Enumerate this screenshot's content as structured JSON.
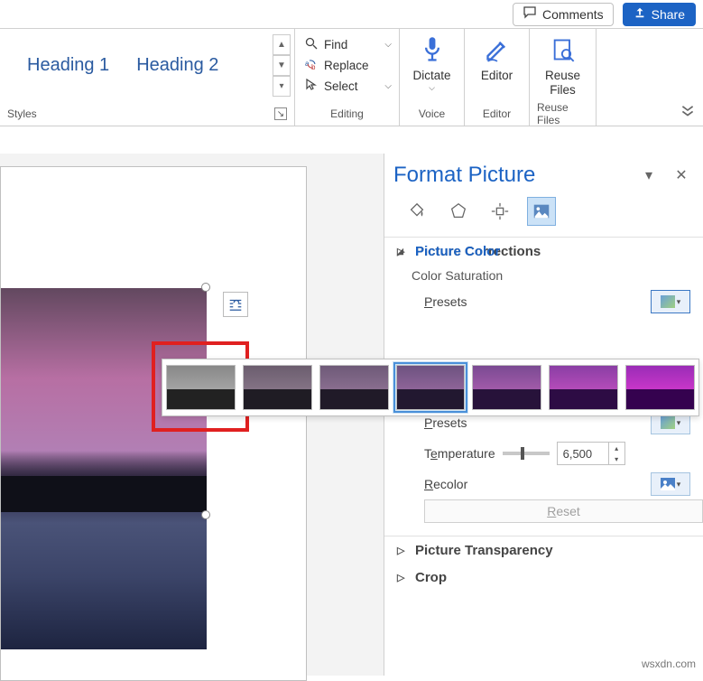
{
  "topbar": {
    "comments": "Comments",
    "share": "Share"
  },
  "ribbon": {
    "styles": {
      "heading1": "Heading 1",
      "heading2": "Heading 2",
      "label": "Styles"
    },
    "editing": {
      "find": "Find",
      "replace": "Replace",
      "select": "Select",
      "label": "Editing"
    },
    "dictate": {
      "label": "Dictate",
      "group": "Voice"
    },
    "editor": {
      "label": "Editor",
      "group": "Editor"
    },
    "reuse": {
      "label": "Reuse\nFiles",
      "group": "Reuse Files"
    }
  },
  "pane": {
    "title": "Format Picture",
    "sections": {
      "corrections": "Picture Corrections",
      "color": "Picture Color",
      "saturation_label": "Color Saturation",
      "presets": "Presets",
      "presets2": "Presets",
      "temperature": "Temperature",
      "temperature_value": "6,500",
      "recolor": "Recolor",
      "reset": "Reset",
      "transparency": "Picture Transparency",
      "crop": "Crop"
    }
  },
  "watermark": "wsxdn.com"
}
